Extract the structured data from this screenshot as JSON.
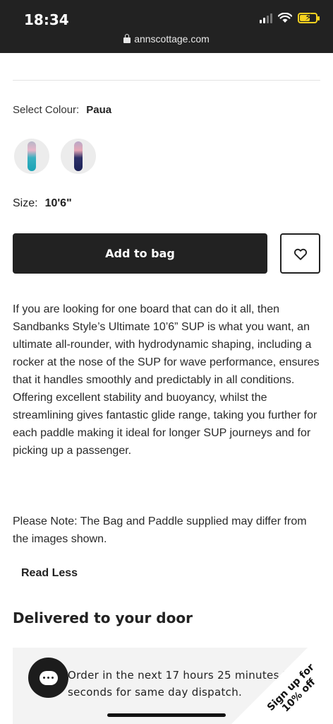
{
  "status_bar": {
    "time": "18:34",
    "url": "annscottage.com",
    "battery_color": "#f5d21f"
  },
  "product": {
    "colour_label": "Select Colour:",
    "colour_value": "Paua",
    "swatches": [
      {
        "name": "teal",
        "color": "#1aa3b5"
      },
      {
        "name": "navy",
        "color": "#1b2156"
      }
    ],
    "size_label": "Size:",
    "size_value": "10'6\"",
    "add_to_bag_label": "Add to bag",
    "wishlist_icon": "heart-icon",
    "description": "If you are looking for one board that can do it all, then Sandbanks Style’s Ultimate 10’6” SUP is what you want, an ultimate all-rounder, with hydrodynamic shaping, including a rocker at the nose of the SUP for wave performance, ensures that it handles smoothly and predictably in all conditions. Offering excellent stability and buoyancy, whilst the streamlining gives fantastic glide range, taking you further for each paddle making it ideal for longer SUP journeys and for picking up a passenger.",
    "note": "Please Note: The Bag and Paddle supplied may differ from the images shown.",
    "read_less_label": "Read Less"
  },
  "delivery": {
    "heading": "Delivered to your door",
    "dispatch_text": "Order in the next 17 hours 25 minutes 22 seconds for same day dispatch."
  },
  "widgets": {
    "chat_icon": "chat-bubble-icon",
    "signup_label": "Sign up for 10% off"
  }
}
